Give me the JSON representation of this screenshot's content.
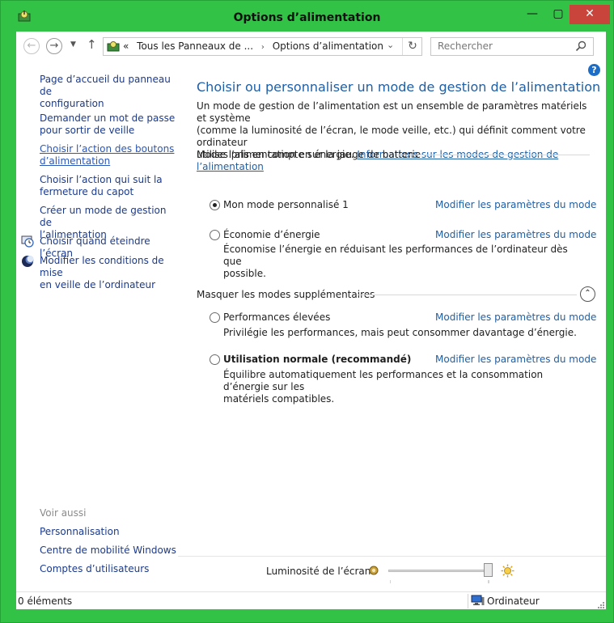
{
  "window": {
    "title": "Options d’alimentation",
    "minimize": "—",
    "maximize": "▢",
    "close": "✕"
  },
  "navbar": {
    "back": "←",
    "forward": "→",
    "recent": "▼",
    "up": "↑",
    "address": {
      "prefix": "«",
      "crumb1": "Tous les Panneaux de ...",
      "separator": "›",
      "crumb2": "Options d’alimentation",
      "dropdown": "⌄",
      "refresh": "↻"
    },
    "search_placeholder": "Rechercher"
  },
  "help": "?",
  "sidebar": {
    "items": [
      {
        "label1": "Page d’accueil du panneau de",
        "label2": "configuration"
      },
      {
        "label1": "Demander un mot de passe",
        "label2": "pour sortir de veille"
      },
      {
        "label1": "Choisir l’action des boutons",
        "label2": "d’alimentation"
      },
      {
        "label1": "Choisir l’action qui suit la",
        "label2": "fermeture du capot"
      },
      {
        "label1": "Créer un mode de gestion de",
        "label2": "l’alimentation"
      },
      {
        "label1": "Choisir quand éteindre l’écran"
      },
      {
        "label1": "Modifier les conditions de mise",
        "label2": "en veille de l’ordinateur"
      }
    ],
    "see_also": "Voir aussi",
    "see_also_links": [
      "Personnalisation",
      "Centre de mobilité Windows",
      "Comptes d’utilisateurs"
    ]
  },
  "main": {
    "title": "Choisir ou personnaliser un mode de gestion de l’alimentation",
    "intro_line1": "Un mode de gestion de l’alimentation est un ensemble de paramètres matériels et système",
    "intro_line2": "(comme la luminosité de l’écran, le mode veille, etc.) qui définit comment votre ordinateur",
    "intro_line3": "utilise l’alimentation en énergie.",
    "intro_link": "Informations sur les modes de gestion de l’alimentation",
    "group1_header": "Modes pris en compte sur la jauge de batterie",
    "group2_header": "Masquer les modes supplémentaires",
    "collapse": "⌃",
    "plans": [
      {
        "name": "Mon mode personnalisé 1",
        "link": "Modifier les paramètres du mode",
        "selected": true
      },
      {
        "name": "Économie d’énergie",
        "link": "Modifier les paramètres du mode",
        "desc1": "Économise l’énergie en réduisant les performances de l’ordinateur dès que",
        "desc2": "possible.",
        "selected": false
      },
      {
        "name": "Performances élevées",
        "link": "Modifier les paramètres du mode",
        "desc1": "Privilégie les performances, mais peut consommer davantage d’énergie.",
        "selected": false
      },
      {
        "name": "Utilisation normale (recommandé)",
        "link": "Modifier les paramètres du mode",
        "desc1": "Équilibre automatiquement les performances et la consommation d’énergie sur les",
        "desc2": "matériels compatibles.",
        "selected": false
      }
    ]
  },
  "brightness": {
    "label": "Luminosité de l’écran :",
    "level_percent": 100
  },
  "statusbar": {
    "items_count": "0 éléments",
    "location": "Ordinateur"
  },
  "colors": {
    "frame": "#31c246",
    "link": "#1f5fa6",
    "close": "#c9443a"
  }
}
